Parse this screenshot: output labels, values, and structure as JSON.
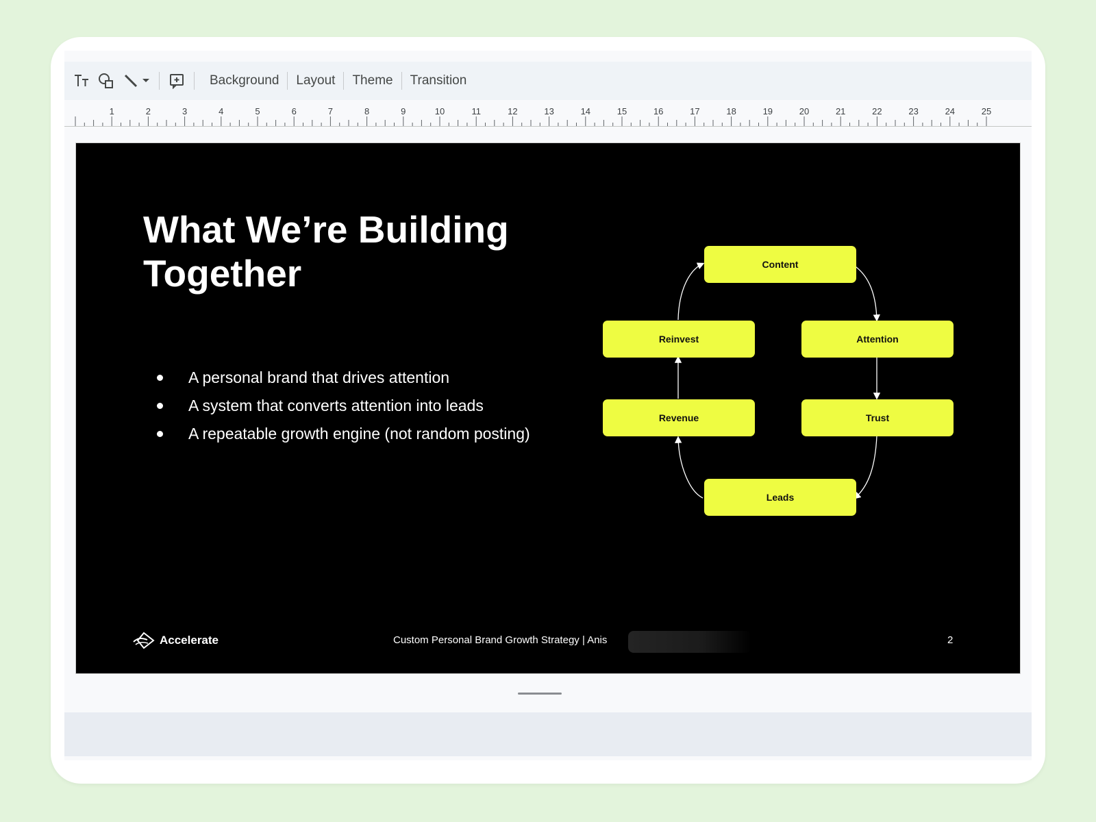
{
  "toolbar": {
    "icons": [
      "text-format-icon",
      "shapes-icon",
      "line-icon",
      "dropdown-icon",
      "add-comment-icon"
    ],
    "background_label": "Background",
    "layout_label": "Layout",
    "theme_label": "Theme",
    "transition_label": "Transition"
  },
  "ruler": {
    "labels": [
      "1",
      "2",
      "3",
      "4",
      "5",
      "6",
      "7",
      "8",
      "9",
      "10",
      "11",
      "12",
      "13",
      "14",
      "15",
      "16",
      "17",
      "18",
      "19",
      "20",
      "21",
      "22",
      "23",
      "24",
      "25"
    ]
  },
  "slide": {
    "title": "What We’re Building Together",
    "bullets": [
      "A personal brand that drives attention",
      "A system that converts attention into leads",
      "A repeatable growth engine (not random posting)"
    ],
    "cycle": {
      "nodes": [
        "Content",
        "Attention",
        "Trust",
        "Leads",
        "Revenue",
        "Reinvest"
      ],
      "node_color": "#eefc42"
    },
    "logo_text": "Accelerate",
    "footer_text": "Custom Personal Brand Growth Strategy  | Anis",
    "page_number": "2",
    "background_color": "#000000"
  },
  "colors": {
    "page_background": "#e3f4dc",
    "toolbar_background": "#eff3f7"
  }
}
